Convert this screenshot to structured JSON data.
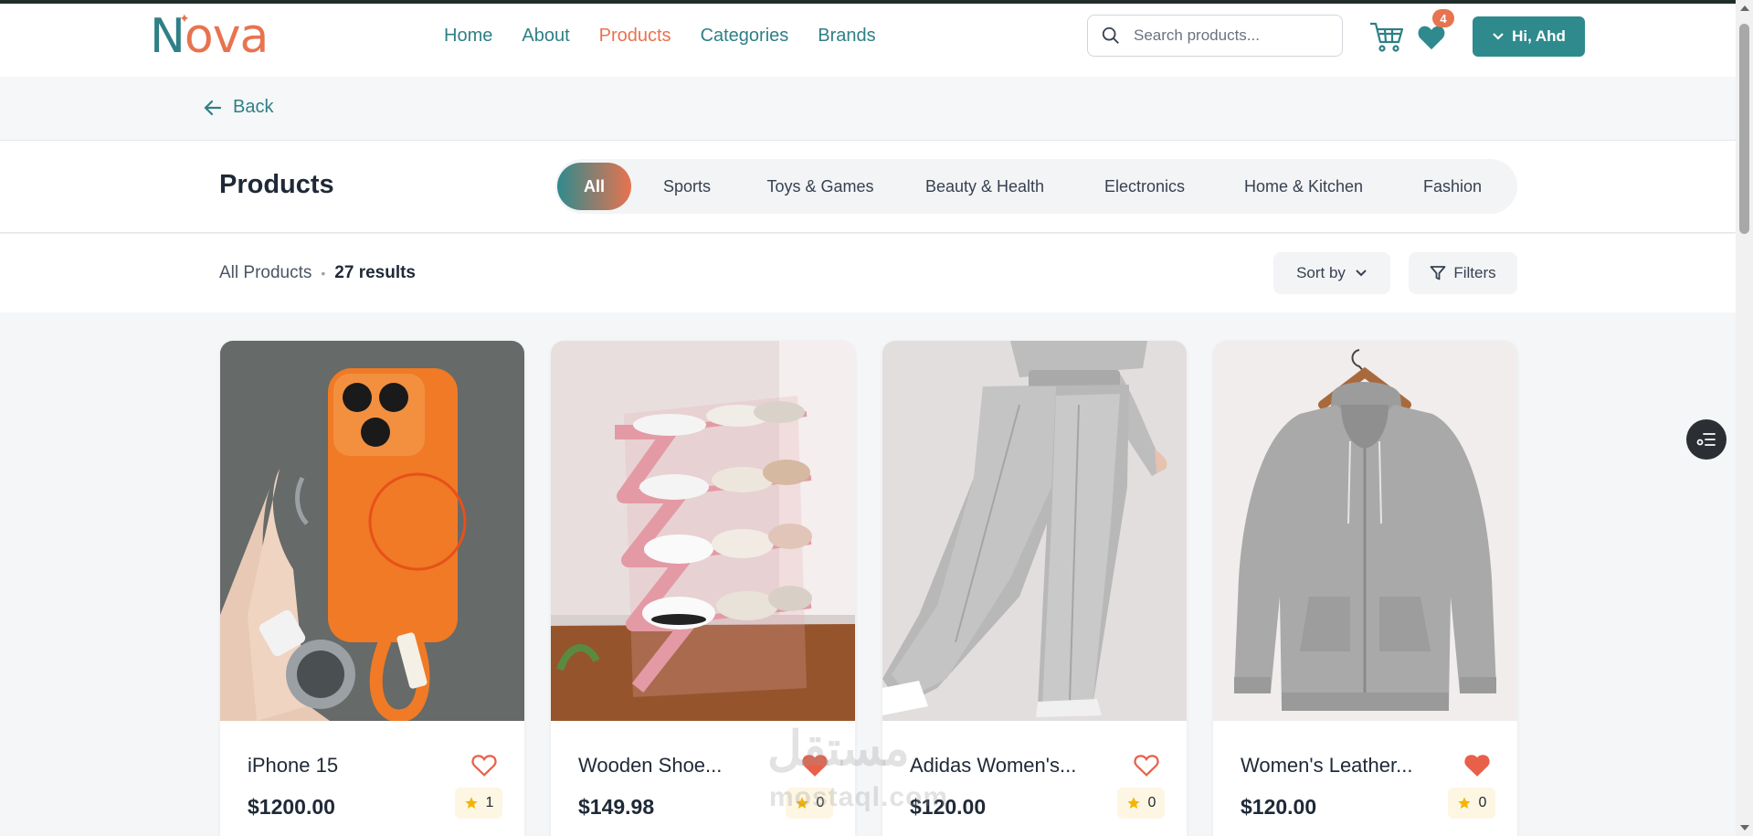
{
  "brand": {
    "logo_text": "Nova"
  },
  "nav": {
    "links": [
      "Home",
      "About",
      "Products",
      "Categories",
      "Brands"
    ],
    "active": "Products",
    "search_placeholder": "Search products...",
    "wishlist_count": "4",
    "user_label": "Hi, Ahd"
  },
  "back": {
    "label": "Back"
  },
  "page": {
    "title": "Products"
  },
  "categories": [
    "All",
    "Sports",
    "Toys & Games",
    "Beauty & Health",
    "Electronics",
    "Home & Kitchen",
    "Fashion"
  ],
  "active_category": "All",
  "results": {
    "label": "All Products",
    "count_text": "27 results"
  },
  "toolbar": {
    "sort_label": "Sort by",
    "filter_label": "Filters"
  },
  "products": [
    {
      "name": "iPhone 15",
      "price": "$1200.00",
      "rating": "1",
      "favorited": false
    },
    {
      "name": "Wooden Shoe...",
      "price": "$149.98",
      "rating": "0",
      "favorited": true
    },
    {
      "name": "Adidas Women's...",
      "price": "$120.00",
      "rating": "0",
      "favorited": false
    },
    {
      "name": "Women's Leather...",
      "price": "$120.00",
      "rating": "0",
      "favorited": true
    }
  ],
  "watermark": {
    "arabic": "مستقل",
    "latin": "mostaql.com"
  },
  "colors": {
    "teal": "#2f8a8d",
    "coral": "#e8734f",
    "star": "#f5b400"
  },
  "icons": [
    "search-icon",
    "cart-icon",
    "heart-icon",
    "chevron-down-icon",
    "arrow-left-icon",
    "filter-icon",
    "star-icon",
    "list-settings-icon"
  ]
}
